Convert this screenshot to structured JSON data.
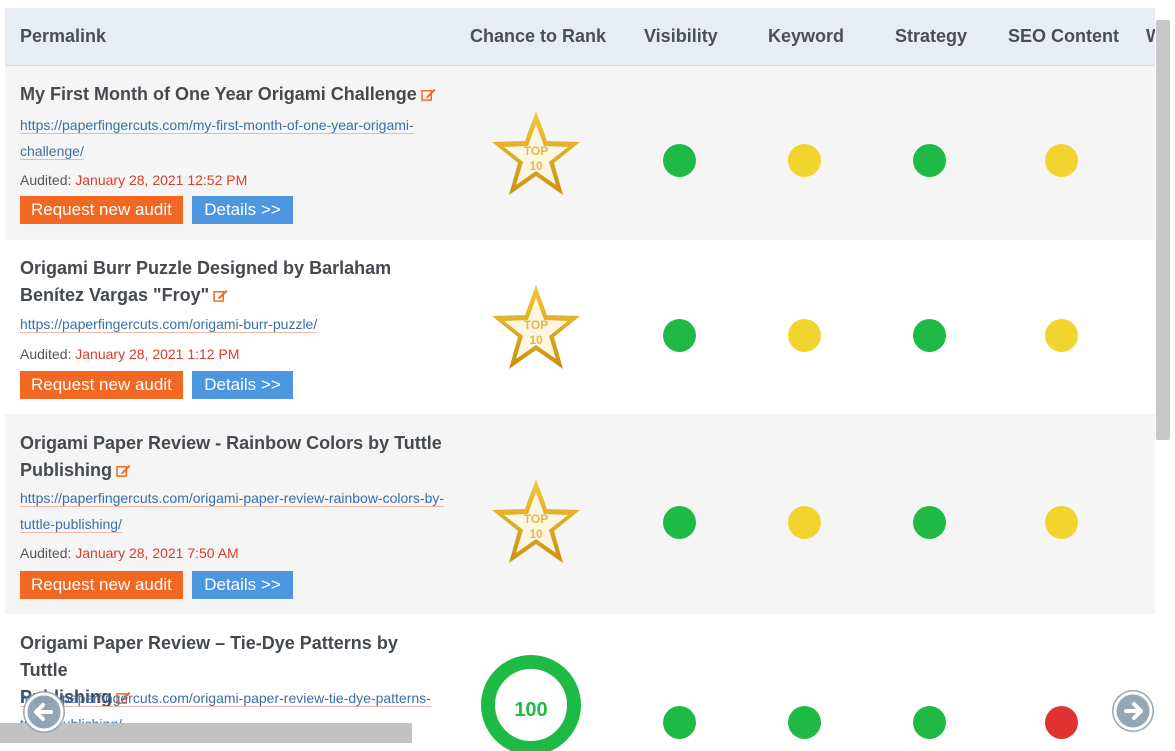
{
  "header": {
    "permalink": "Permalink",
    "chance": "Chance to Rank",
    "visibility": "Visibility",
    "keyword": "Keyword",
    "strategy": "Strategy",
    "seo_content": "SEO Content",
    "cut_col": "W"
  },
  "labels": {
    "audited": "Audited:",
    "request": "Request new audit",
    "details": "Details >>",
    "top": "TOP",
    "ten": "10"
  },
  "colors": {
    "green": "#1fba46",
    "yellow": "#f2d42f",
    "red": "#e03232",
    "orange": "#f26722",
    "blue": "#4d97e1"
  },
  "rows": [
    {
      "title": "My First Month of One Year Origami Challenge",
      "url_line1": "https://paperfingercuts.com/my-first-month-of-one-year-origami-",
      "url_line2": "challenge/",
      "audit_date": "January 28, 2021 12:52 PM",
      "rank": "top10",
      "status": [
        "green",
        "yellow",
        "green",
        "yellow"
      ]
    },
    {
      "title_line1": "Origami Burr Puzzle Designed by Barlaham",
      "title_line2": "Benítez Vargas \"Froy\"",
      "url_line1": "https://paperfingercuts.com/origami-burr-puzzle/",
      "audit_date": "January 28, 2021 1:12 PM",
      "rank": "top10",
      "status": [
        "green",
        "yellow",
        "green",
        "yellow"
      ]
    },
    {
      "title_line1": "Origami Paper Review - Rainbow Colors by Tuttle",
      "title_line2": "Publishing",
      "url_line1": "https://paperfingercuts.com/origami-paper-review-rainbow-colors-by-",
      "url_line2": "tuttle-publishing/",
      "audit_date": "January 28, 2021 7:50 AM",
      "rank": "top10",
      "status": [
        "green",
        "yellow",
        "green",
        "yellow"
      ]
    },
    {
      "title_line1": "Origami Paper Review – Tie-Dye Patterns by Tuttle",
      "title_line2": "Publishing",
      "url_line1": "https://paperfingercuts.com/origami-paper-review-tie-dye-patterns-",
      "url_line2": "tuttle-publishing/",
      "rank_value": "100",
      "status": [
        "green",
        "green",
        "green",
        "red"
      ]
    }
  ]
}
